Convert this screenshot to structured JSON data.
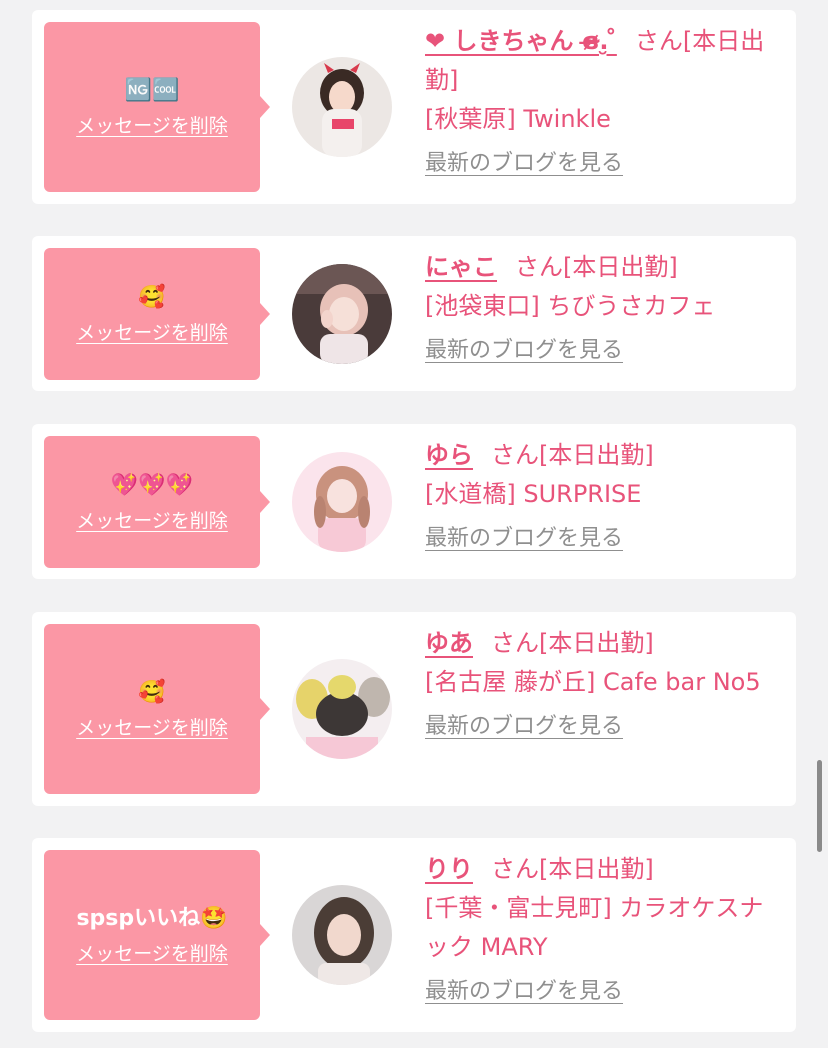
{
  "common": {
    "delete_label": "メッセージを削除",
    "blog_label": "最新のブログを見る",
    "status_suffix": "さん[本日出勤]"
  },
  "colors": {
    "bubble": "#fb97a5",
    "accent": "#e8537a",
    "muted": "#8f8f8f",
    "background": "#f2f2f3"
  },
  "cards": [
    {
      "message": "🆖🆒",
      "name": "❤ しきちゃん ɞ̴̶̷.̮ ̊",
      "shop": "[秋葉原] Twinkle",
      "avatar_icon": "profile-photo"
    },
    {
      "message": "🥰",
      "name": "にゃこ",
      "shop": "[池袋東口] ちびうさカフェ",
      "avatar_icon": "profile-photo"
    },
    {
      "message": "💖💖💖",
      "name": "ゆら",
      "shop": "[水道橋] SURPRISE",
      "avatar_icon": "profile-photo"
    },
    {
      "message": "🥰",
      "name": "ゆあ",
      "shop": "[名古屋 藤が丘] Cafe bar No5",
      "avatar_icon": "profile-photo"
    },
    {
      "message": "spspいいね🤩",
      "name": "りり",
      "shop": "[千葉・富士見町] カラオケスナック MARY",
      "avatar_icon": "profile-photo"
    }
  ]
}
